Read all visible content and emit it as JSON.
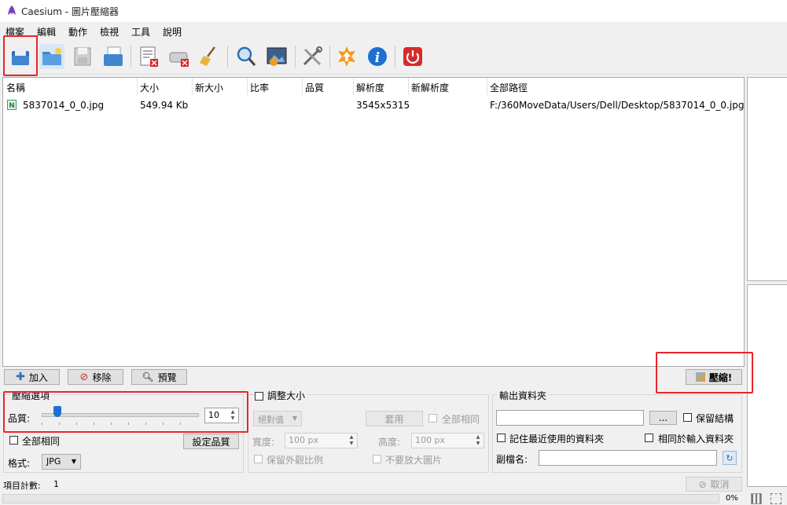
{
  "window": {
    "title": "Caesium - 圖片壓縮器"
  },
  "menu": [
    "檔案",
    "編輯",
    "動作",
    "檢視",
    "工具",
    "說明"
  ],
  "toolbar": {
    "buttons": [
      {
        "name": "open-file-icon"
      },
      {
        "name": "open-folder-icon"
      },
      {
        "name": "save-list-icon"
      },
      {
        "name": "open-list-icon"
      },
      {
        "name": "remove-item-icon"
      },
      {
        "name": "clear-list-icon"
      },
      {
        "name": "broom-icon"
      },
      {
        "name": "search-icon"
      },
      {
        "name": "image-preview-icon"
      },
      {
        "name": "tools-icon"
      },
      {
        "name": "update-icon"
      },
      {
        "name": "info-icon"
      },
      {
        "name": "power-icon"
      }
    ]
  },
  "filelist": {
    "columns": [
      "名稱",
      "大小",
      "新大小",
      "比率",
      "品質",
      "解析度",
      "新解析度",
      "全部路徑"
    ],
    "rows": [
      {
        "name": "5837014_0_0.jpg",
        "size": "549.94 Kb",
        "new_size": "",
        "ratio": "",
        "quality": "",
        "resolution": "3545x5315",
        "new_resolution": "",
        "path": "F:/360MoveData/Users/Dell/Desktop/5837014_0_0.jpg"
      }
    ]
  },
  "actions": {
    "add": "加入",
    "remove": "移除",
    "preview": "預覽",
    "compress": "壓縮!"
  },
  "compression": {
    "title": "壓縮選項",
    "quality_label": "品質:",
    "quality_value": "10",
    "same_for_all": "全部相同",
    "set_quality": "設定品質",
    "format_label": "格式:",
    "format_value": "JPG"
  },
  "resize": {
    "title": "調整大小",
    "mode": "絕對值",
    "apply": "套用",
    "same_for_all": "全部相同",
    "width_label": "寬度:",
    "width_value": "100 px",
    "height_label": "高度:",
    "height_value": "100 px",
    "keep_aspect": "保留外觀比例",
    "no_enlarge": "不要放大圖片"
  },
  "output": {
    "title": "輸出資料夾",
    "browse": "...",
    "keep_structure": "保留結構",
    "remember_last": "記住最近使用的資料夾",
    "same_as_input": "相同於輸入資料夾",
    "suffix_label": "副檔名:"
  },
  "status": {
    "item_count_label": "項目計數:",
    "item_count": "1",
    "cancel": "取消",
    "progress": "0%"
  },
  "colors": {
    "highlight": "#e8262b",
    "accent": "#1f6fd1"
  }
}
